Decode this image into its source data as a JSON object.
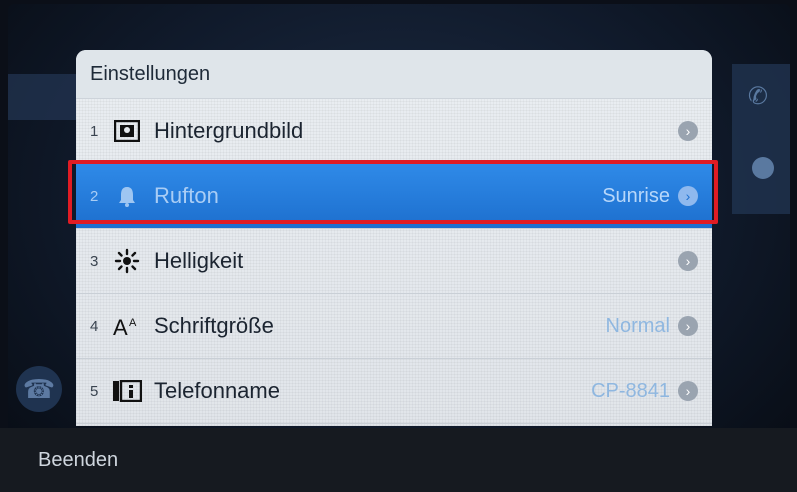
{
  "panel": {
    "title": "Einstellungen"
  },
  "items": [
    {
      "num": "1",
      "icon": "wallpaper-icon",
      "label": "Hintergrundbild",
      "value": ""
    },
    {
      "num": "2",
      "icon": "bell-icon",
      "label": "Rufton",
      "value": "Sunrise",
      "selected": true
    },
    {
      "num": "3",
      "icon": "brightness-icon",
      "label": "Helligkeit",
      "value": ""
    },
    {
      "num": "4",
      "icon": "font-size-icon",
      "label": "Schriftgröße",
      "value": "Normal"
    },
    {
      "num": "5",
      "icon": "phone-name-icon",
      "label": "Telefonname",
      "value": "CP-8841"
    }
  ],
  "softkeys": {
    "exit": "Beenden"
  },
  "colors": {
    "selected": "#2f8ae8",
    "highlight_border": "#e01c24"
  }
}
